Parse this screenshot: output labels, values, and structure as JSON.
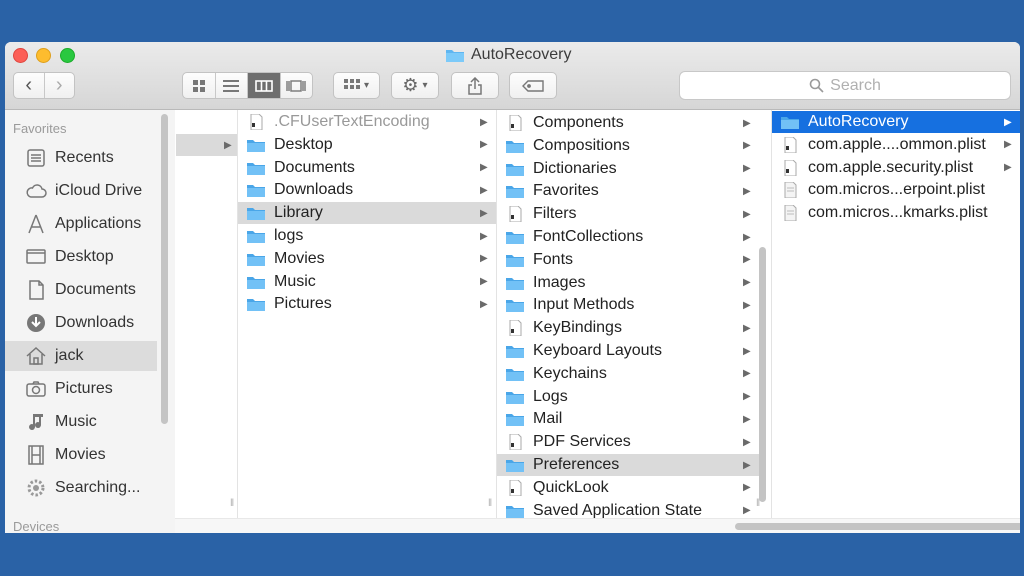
{
  "window": {
    "title": "AutoRecovery"
  },
  "search": {
    "placeholder": "Search"
  },
  "sidebar": {
    "favorites_header": "Favorites",
    "devices_header": "Devices",
    "items": [
      {
        "label": "Recents",
        "icon": "recents-icon"
      },
      {
        "label": "iCloud Drive",
        "icon": "cloud-icon"
      },
      {
        "label": "Applications",
        "icon": "applications-icon"
      },
      {
        "label": "Desktop",
        "icon": "desktop-icon"
      },
      {
        "label": "Documents",
        "icon": "documents-icon"
      },
      {
        "label": "Downloads",
        "icon": "downloads-icon"
      },
      {
        "label": "jack",
        "icon": "home-icon",
        "selected": true
      },
      {
        "label": "Pictures",
        "icon": "camera-icon"
      },
      {
        "label": "Music",
        "icon": "music-icon"
      },
      {
        "label": "Movies",
        "icon": "film-icon"
      },
      {
        "label": "Searching...",
        "icon": "gear-icon"
      }
    ]
  },
  "columns": {
    "home": [
      {
        "name": ".CFUserTextEncoding",
        "type": "file",
        "dim": true
      },
      {
        "name": "Desktop",
        "type": "folder"
      },
      {
        "name": "Documents",
        "type": "folder"
      },
      {
        "name": "Downloads",
        "type": "folder"
      },
      {
        "name": "Library",
        "type": "folder",
        "selected": true
      },
      {
        "name": "logs",
        "type": "folder"
      },
      {
        "name": "Movies",
        "type": "folder"
      },
      {
        "name": "Music",
        "type": "folder"
      },
      {
        "name": "Pictures",
        "type": "folder"
      }
    ],
    "library": [
      {
        "name": "Components",
        "type": "file"
      },
      {
        "name": "Compositions",
        "type": "folder"
      },
      {
        "name": "Dictionaries",
        "type": "folder"
      },
      {
        "name": "Favorites",
        "type": "folder"
      },
      {
        "name": "Filters",
        "type": "file"
      },
      {
        "name": "FontCollections",
        "type": "folder"
      },
      {
        "name": "Fonts",
        "type": "folder"
      },
      {
        "name": "Images",
        "type": "folder"
      },
      {
        "name": "Input Methods",
        "type": "folder"
      },
      {
        "name": "KeyBindings",
        "type": "file"
      },
      {
        "name": "Keyboard Layouts",
        "type": "folder"
      },
      {
        "name": "Keychains",
        "type": "folder"
      },
      {
        "name": "Logs",
        "type": "folder"
      },
      {
        "name": "Mail",
        "type": "folder"
      },
      {
        "name": "PDF Services",
        "type": "file"
      },
      {
        "name": "Preferences",
        "type": "folder",
        "selected": true
      },
      {
        "name": "QuickLook",
        "type": "file"
      },
      {
        "name": "Saved Application State",
        "type": "folder"
      }
    ],
    "preferences": [
      {
        "name": "AutoRecovery",
        "type": "folder",
        "selected": true
      },
      {
        "name": "com.apple....ommon.plist",
        "type": "file"
      },
      {
        "name": "com.apple.security.plist",
        "type": "file"
      },
      {
        "name": "com.micros...erpoint.plist",
        "type": "doc"
      },
      {
        "name": "com.micros...kmarks.plist",
        "type": "doc"
      }
    ]
  },
  "colors": {
    "accent": "#1670e0",
    "background": "#2a62a6"
  }
}
